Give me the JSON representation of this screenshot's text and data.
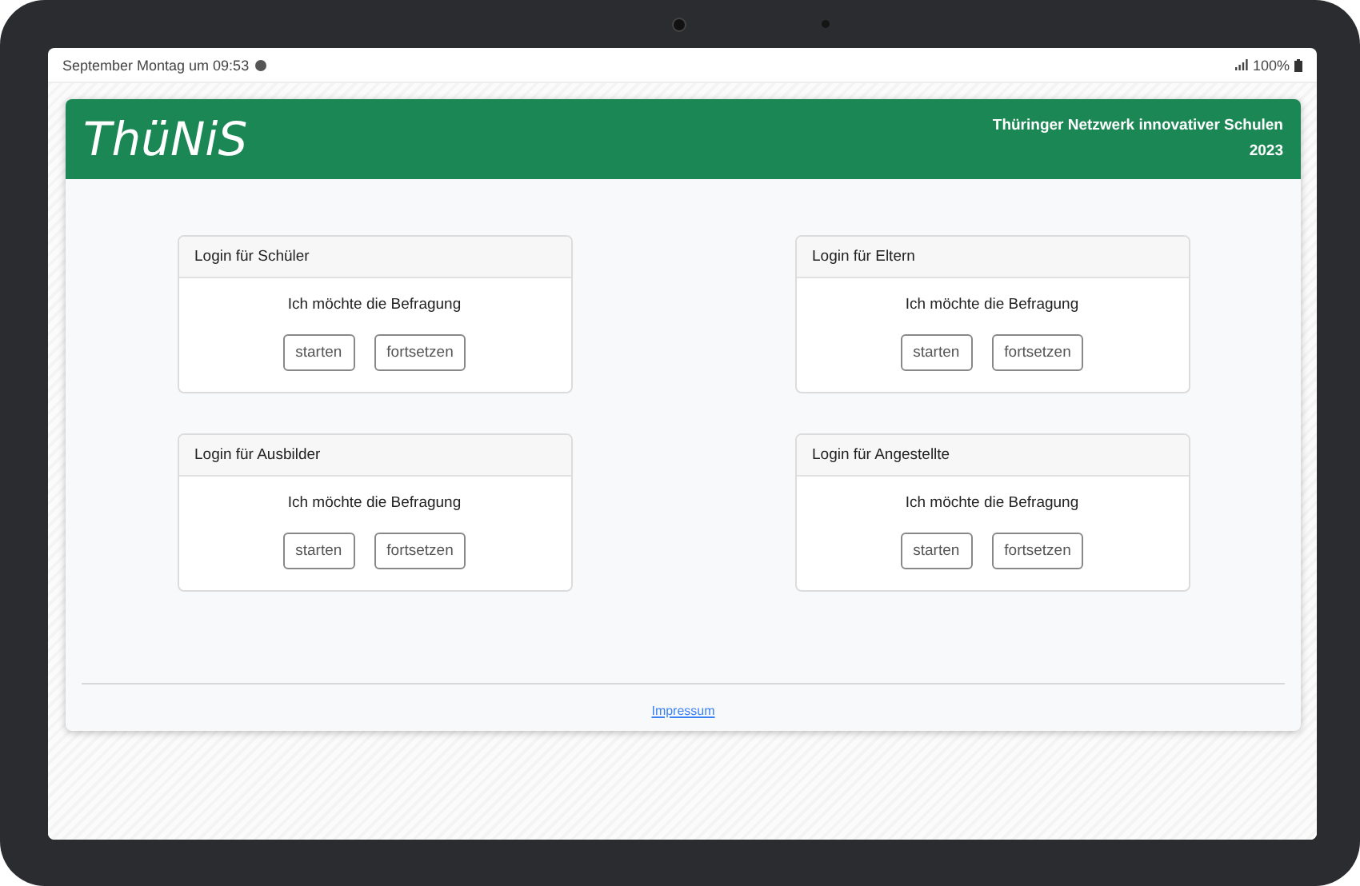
{
  "status_bar": {
    "time": "September Montag um 09:53",
    "battery": "100%"
  },
  "header": {
    "logo": "ThüNiS",
    "subtitle": [
      "Thüringer Netzwerk innovativer Schulen",
      "2023"
    ]
  },
  "cards": [
    {
      "title": "Login für Schüler",
      "text": "Ich möchte die Befragung",
      "buttons": [
        "starten",
        "fortsetzen"
      ]
    },
    {
      "title": "Login für Eltern",
      "text": "Ich möchte die Befragung",
      "buttons": [
        "starten",
        "fortsetzen"
      ]
    },
    {
      "title": "Login für Ausbilder",
      "text": "Ich möchte die Befragung",
      "buttons": [
        "starten",
        "fortsetzen"
      ]
    },
    {
      "title": "Login für Angestellte",
      "text": "Ich möchte die Befragung",
      "buttons": [
        "starten",
        "fortsetzen"
      ]
    }
  ],
  "footer": {
    "link": "Impressum"
  }
}
